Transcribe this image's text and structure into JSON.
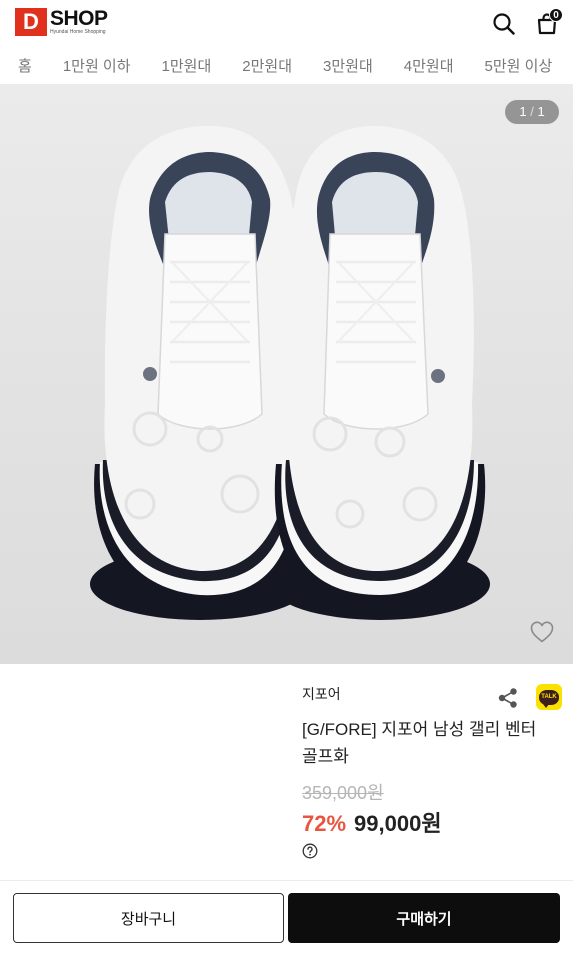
{
  "header": {
    "logo_mark": "D",
    "logo_word": "SHOP",
    "logo_sub": "Hyundai Home Shopping",
    "search_icon": "search-icon",
    "cart_icon": "shopping-bag-icon",
    "cart_count": "0"
  },
  "categories": [
    "홈",
    "1만원 이하",
    "1만원대",
    "2만원대",
    "3만원대",
    "4만원대",
    "5만원 이상"
  ],
  "gallery": {
    "current": "1",
    "separator": "/",
    "total": "1",
    "wish_icon": "heart-outline-icon",
    "image_alt": "white golf shoes"
  },
  "product": {
    "brand": "지포어",
    "title": "[G/FORE] 지포어 남성 갤리 벤터 골프화",
    "original_price": "359,000원",
    "discount_rate": "72%",
    "sale_price": "99,000원",
    "share_icon": "share-icon",
    "kakao_talk_label": "TALK",
    "help_icon": "question-circle-icon"
  },
  "actions": {
    "add_to_cart": "장바구니",
    "buy_now": "구매하기"
  },
  "colors": {
    "brand_red": "#e0301e",
    "discount": "#e8553f",
    "kakao_yellow": "#fae100",
    "buy_button": "#0d0d0d"
  }
}
